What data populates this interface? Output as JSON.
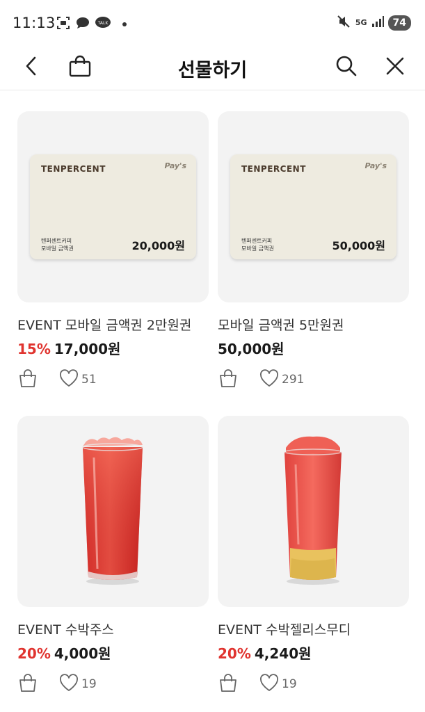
{
  "status_bar": {
    "time": "11:13",
    "network": "5G",
    "battery": "74"
  },
  "header": {
    "title": "선물하기"
  },
  "products": [
    {
      "kind": "gift-card",
      "name": "EVENT 모바일 금액권 2만원권",
      "discount": "15%",
      "price": "17,000원",
      "likes": "51",
      "card": {
        "brand": "TENPERCENT",
        "pay": "Pay's",
        "line1": "텐퍼센트커피",
        "line2": "모바일 금액권",
        "amount": "20,000원"
      }
    },
    {
      "kind": "gift-card",
      "name": "모바일 금액권 5만원권",
      "discount": "",
      "price": "50,000원",
      "likes": "291",
      "card": {
        "brand": "TENPERCENT",
        "pay": "Pay's",
        "line1": "텐퍼센트커피",
        "line2": "모바일 금액권",
        "amount": "50,000원"
      }
    },
    {
      "kind": "drink-juice",
      "name": "EVENT 수박주스",
      "discount": "20%",
      "price": "4,000원",
      "likes": "19"
    },
    {
      "kind": "drink-smoothie",
      "name": "EVENT 수박젤리스무디",
      "discount": "20%",
      "price": "4,240원",
      "likes": "19"
    }
  ],
  "colors": {
    "discount": "#e0342f",
    "thumb_bg": "#f3f3f3",
    "card_bg": "#eeebe0"
  }
}
